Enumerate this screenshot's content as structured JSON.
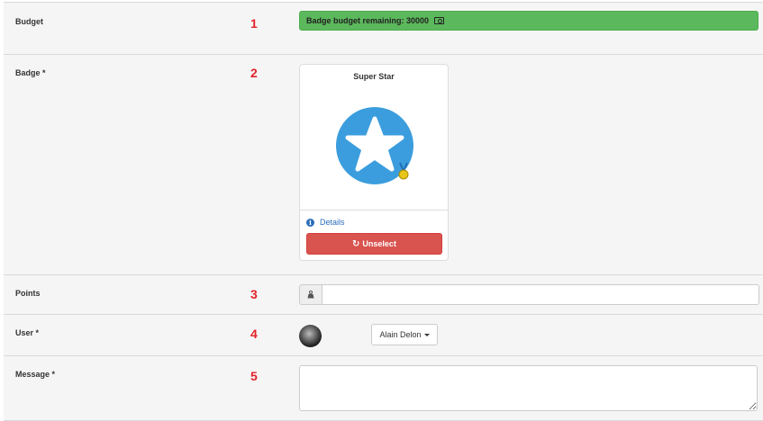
{
  "budget": {
    "label": "Budget",
    "number": "1",
    "remaining_text": "Badge budget remaining: 30000",
    "icon": "money-icon",
    "color": "#5cb85c"
  },
  "badge": {
    "label": "Badge *",
    "number": "2",
    "name": "Super Star",
    "image_color": "#3b9ddd",
    "medal_color": "#e8c51a",
    "details_label": "Details",
    "unselect_label": "Unselect",
    "unselect_color": "#d9534f"
  },
  "points": {
    "label": "Points",
    "number": "3",
    "addon_icon": "weight-icon",
    "value": ""
  },
  "user": {
    "label": "User *",
    "number": "4",
    "selected_name": "Alain Delon"
  },
  "message": {
    "label": "Message *",
    "number": "5",
    "value": ""
  }
}
